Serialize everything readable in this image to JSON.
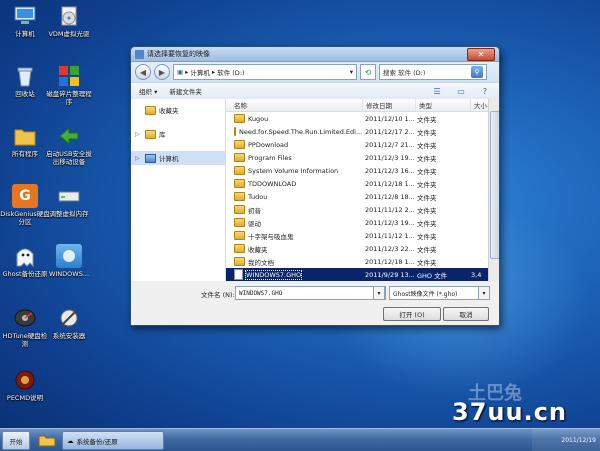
{
  "desktop": {
    "icons": [
      {
        "label": "计算机"
      },
      {
        "label": "VDM虚拟光驱"
      },
      {
        "label": "回收站"
      },
      {
        "label": "磁盘碎片整理程序"
      },
      {
        "label": "所有程序"
      },
      {
        "label": "启动USB安全拔出移动设备"
      },
      {
        "label": "DiskGenius硬盘分区"
      },
      {
        "label": "调整虚拟内存"
      },
      {
        "label": "Ghost备份还原"
      },
      {
        "label": "WINDOWS..."
      },
      {
        "label": "HDTune硬盘检测"
      },
      {
        "label": "系统安装器"
      },
      {
        "label": "PECMD说明"
      }
    ]
  },
  "dialog": {
    "title": "请选择要恢复的映像",
    "close_label": "✕",
    "address": {
      "crumbs": [
        "计算机",
        "软件 (D:)"
      ],
      "separator": "▸"
    },
    "search_placeholder": "搜索 软件 (D:)",
    "toolbar": {
      "organize_label": "组织 ▾",
      "new_folder_label": "新建文件夹"
    },
    "nav": {
      "favorites_label": "收藏夹",
      "libraries_label": "库",
      "computer_label": "计算机"
    },
    "columns": {
      "name": "名称",
      "date": "修改日期",
      "type": "类型",
      "size": "大小"
    },
    "files": [
      {
        "name": "Kugou",
        "date": "2011/12/10 1...",
        "type": "文件夹",
        "size": ""
      },
      {
        "name": "Need.for.Speed.The.Run.Limited.Edi...",
        "date": "2011/12/17 2...",
        "type": "文件夹",
        "size": ""
      },
      {
        "name": "PPDownload",
        "date": "2011/12/7 21...",
        "type": "文件夹",
        "size": ""
      },
      {
        "name": "Program Files",
        "date": "2011/12/3 19...",
        "type": "文件夹",
        "size": ""
      },
      {
        "name": "System Volume Information",
        "date": "2011/12/3 16...",
        "type": "文件夹",
        "size": ""
      },
      {
        "name": "TDDOWNLOAD",
        "date": "2011/12/18 1...",
        "type": "文件夹",
        "size": ""
      },
      {
        "name": "Tudou",
        "date": "2011/12/8 18...",
        "type": "文件夹",
        "size": ""
      },
      {
        "name": "初音",
        "date": "2011/11/12 2...",
        "type": "文件夹",
        "size": ""
      },
      {
        "name": "驱动",
        "date": "2011/12/3 19...",
        "type": "文件夹",
        "size": ""
      },
      {
        "name": "十字架与吸血鬼",
        "date": "2011/11/12 1...",
        "type": "文件夹",
        "size": ""
      },
      {
        "name": "收藏夹",
        "date": "2011/12/3 22...",
        "type": "文件夹",
        "size": ""
      },
      {
        "name": "我的文档",
        "date": "2011/12/18 1...",
        "type": "文件夹",
        "size": ""
      },
      {
        "name": "WINDOWS7.GHO",
        "date": "2011/9/29 13...",
        "type": "GHO 文件",
        "size": "3,4"
      }
    ],
    "filename_label": "文件名 (N):",
    "filename_value": "WINDOWS7.GHO",
    "filetype_value": "Ghost映像文件 (*.gho)",
    "open_label": "打开 (O)",
    "cancel_label": "取消"
  },
  "taskbar": {
    "start_label": "开始",
    "task_label": "系统备份/还原",
    "clock": "2011/12/19"
  },
  "watermark": {
    "brand": "土巴兔",
    "site": "37uu.cn"
  },
  "colors": {
    "selection": "#0a246a",
    "desktop_blue": "#1b5fb4"
  }
}
